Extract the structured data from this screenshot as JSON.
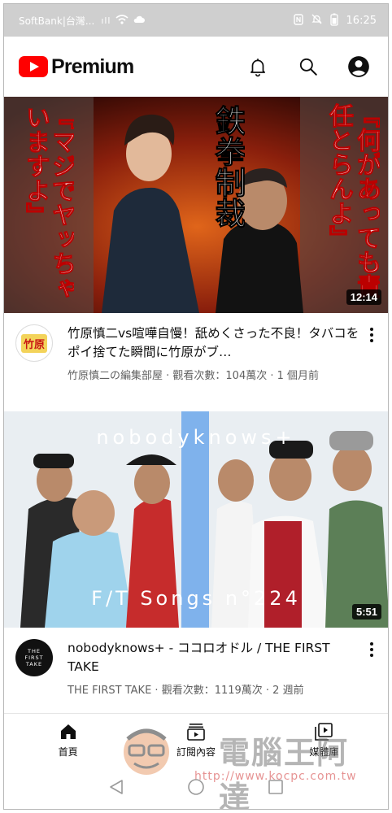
{
  "status_bar": {
    "carrier": "SoftBank|台灣...",
    "signal": "ıll",
    "time": "16:25"
  },
  "header": {
    "brand": "Premium",
    "icons": [
      "notifications-icon",
      "search-icon",
      "account-icon"
    ]
  },
  "videos": [
    {
      "title": "竹原慎二vs喧嘩自慢！舐めくさった不良！タバコをポイ捨てた瞬間に竹原がブ…",
      "channel_line": "竹原慎二の編集部屋 · 觀看次數：104萬次 · 1 個月前",
      "duration": "12:14",
      "thumb_texts": {
        "left": "『マジでヤッちゃいますよ』",
        "center": "鉄拳制裁",
        "right": "『何があっても責任とらんよ』"
      },
      "avatar_text": "竹原"
    },
    {
      "title": "nobodyknows+ - ココロオドル / THE FIRST TAKE",
      "channel_line": "THE FIRST TAKE · 觀看次數：1119萬次 · 2 週前",
      "duration": "5:51",
      "thumb_texts": {
        "top": "nobodyknows+",
        "bottom": "F/T Songs n°224"
      },
      "avatar_text": "THE FIRST TAKE"
    }
  ],
  "bottom_nav": [
    {
      "label": "首頁",
      "icon": "home-icon",
      "active": true
    },
    {
      "label": "訂閱內容",
      "icon": "subscriptions-icon",
      "active": false
    },
    {
      "label": "媒體庫",
      "icon": "library-icon",
      "active": false
    }
  ],
  "watermark": {
    "text": "電腦王阿達",
    "url": "http://www.kocpc.com.tw"
  },
  "colors": {
    "brand_red": "#ff0000",
    "status_bar_bg": "#cfcfcf",
    "secondary_text": "#606060"
  }
}
